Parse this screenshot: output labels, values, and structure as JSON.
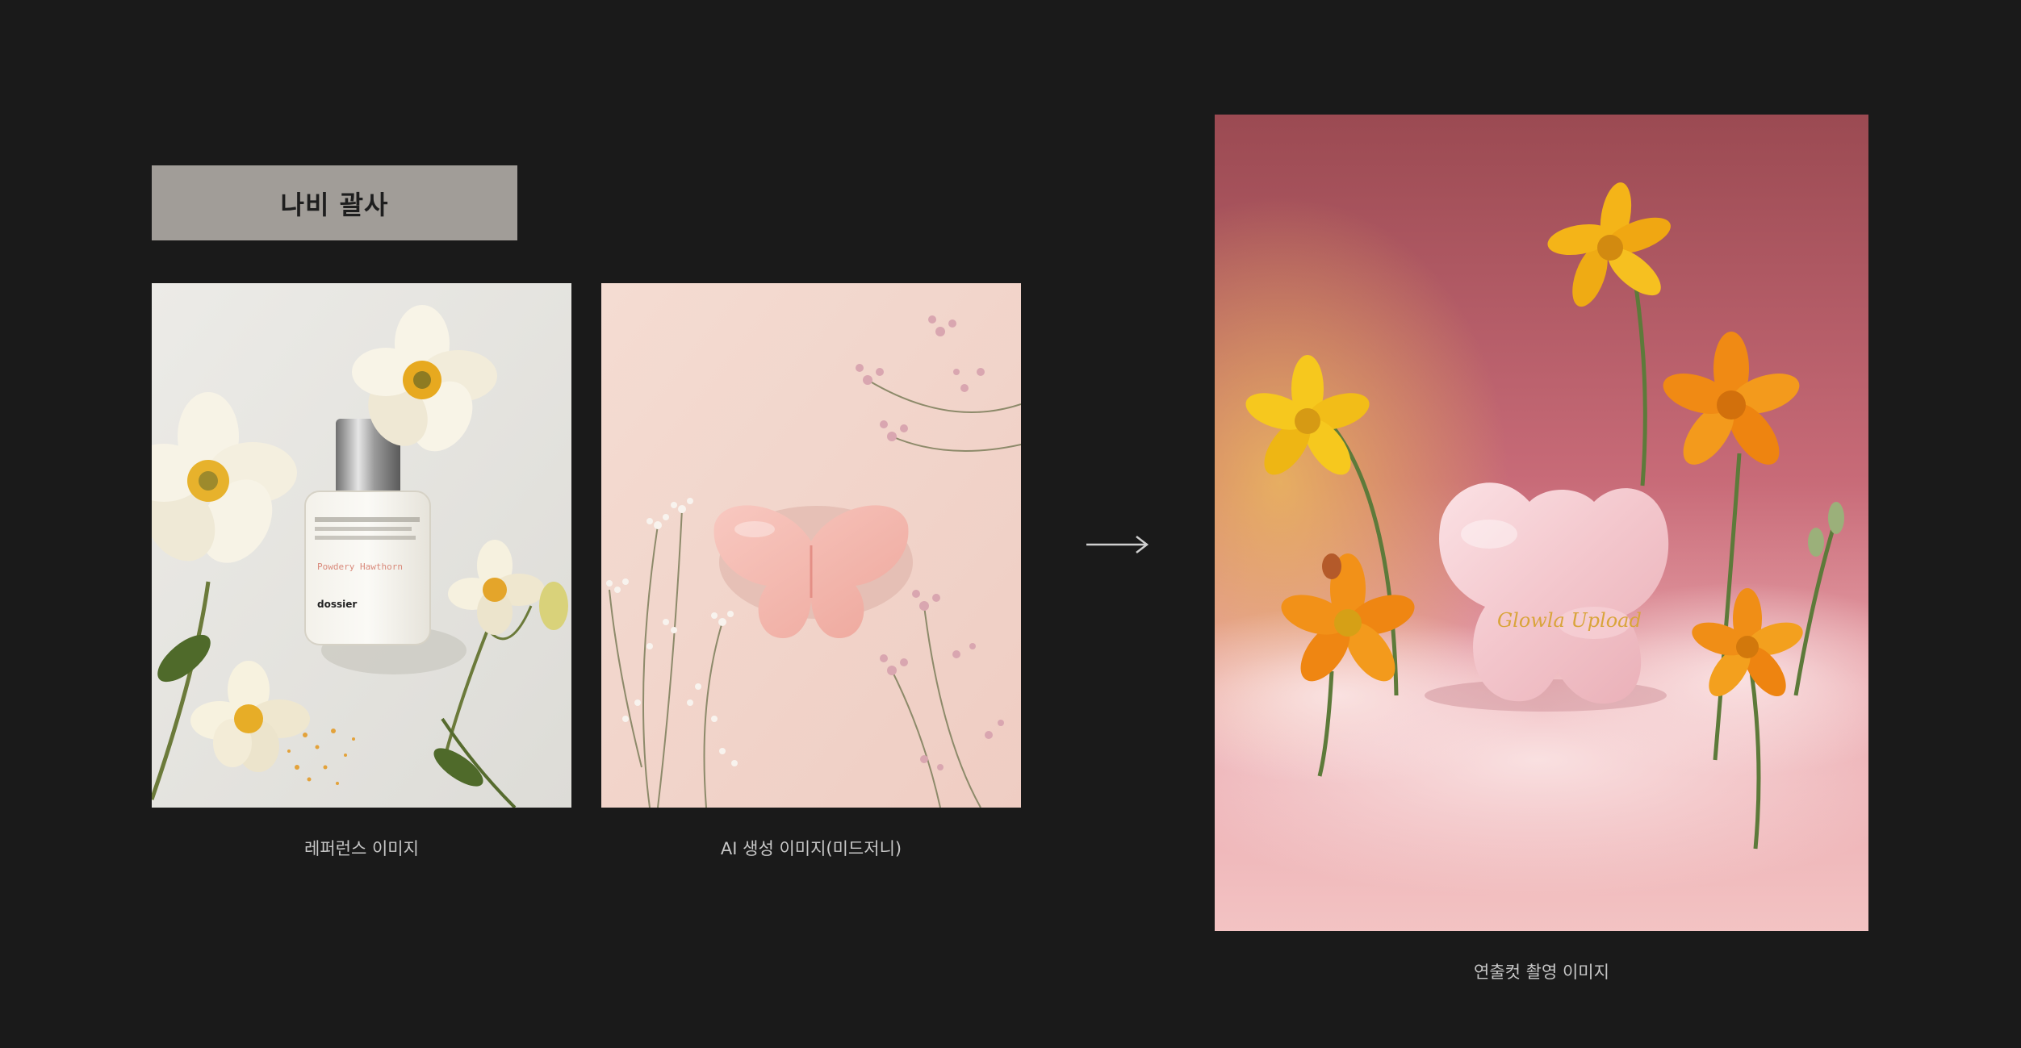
{
  "title_box": {
    "label": "나비 괄사"
  },
  "reference": {
    "caption": "레퍼런스 이미지",
    "bottle_label": "Powdery Hawthorn",
    "bottle_brand": "dossier"
  },
  "ai_generated": {
    "caption": "AI 생성 이미지(미드저니)"
  },
  "final_shot": {
    "caption": "연출컷 촬영 이미지",
    "engraving": "Glowla Upload"
  },
  "icons": {
    "arrow": "arrow-right-icon"
  },
  "colors": {
    "background": "#1a1a1a",
    "title_box": "#a19d98",
    "caption_text": "#c7c7c7"
  }
}
